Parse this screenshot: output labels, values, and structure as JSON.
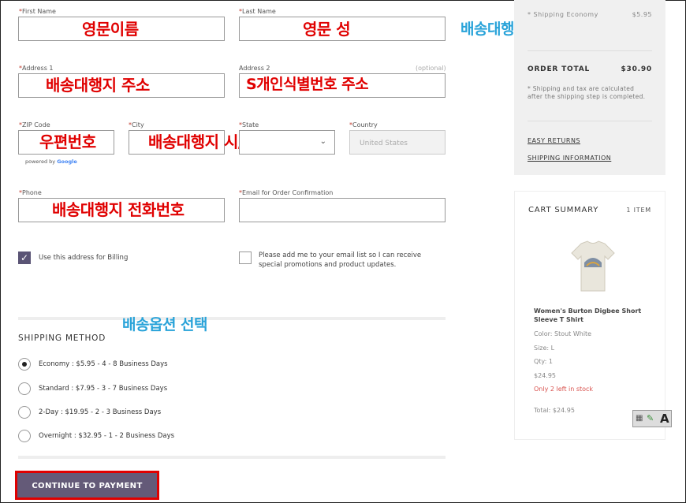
{
  "form": {
    "first_name_label": "First Name",
    "last_name_label": "Last Name",
    "address1_label": "Address 1",
    "address2_label": "Address 2",
    "address2_optional": "(optional)",
    "zip_label": "ZIP Code",
    "city_label": "City",
    "state_label": "State",
    "country_label": "Country",
    "country_value": "United States",
    "powered_by": "powered by",
    "google": "Google",
    "phone_label": "Phone",
    "email_label": "Email for Order Confirmation",
    "billing_checkbox_label": "Use this address for Billing",
    "billing_checked": true,
    "email_list_label": "Please add me to your email list so I can receive special promotions and product updates.",
    "email_list_checked": false
  },
  "annotations": {
    "first_name": "영문이름",
    "last_name": "영문 성",
    "header_hint": "배송대행지 주소입력하기",
    "address1": "배송대행지 주소",
    "address2": "S개인식별번호 주소",
    "zip": "우편번호",
    "city_state": "배송대행지 시/주",
    "phone": "배송대행지 전화번호",
    "shipping_option": "배송옵션 선택"
  },
  "shipping": {
    "title": "SHIPPING METHOD",
    "options": [
      {
        "label": "Economy : $5.95 - 4 - 8 Business Days",
        "selected": true
      },
      {
        "label": "Standard : $7.95 - 3 - 7 Business Days",
        "selected": false
      },
      {
        "label": "2-Day : $19.95 - 2 - 3 Business Days",
        "selected": false
      },
      {
        "label": "Overnight : $32.95 - 1 - 2 Business Days",
        "selected": false
      }
    ]
  },
  "continue_button": "CONTINUE TO PAYMENT",
  "order_summary": {
    "shipping_line_label": "* Shipping Economy",
    "shipping_line_value": "$5.95",
    "order_total_label": "ORDER TOTAL",
    "order_total_value": "$30.90",
    "note": "* Shipping and tax are calculated after the shipping step is completed.",
    "easy_returns": "EASY RETURNS",
    "shipping_info": "SHIPPING INFORMATION"
  },
  "cart": {
    "title": "CART SUMMARY",
    "count": "1 ITEM",
    "item_name": "Women's Burton Digbee Short Sleeve T Shirt",
    "color": "Color: Stout White",
    "size": "Size: L",
    "qty": "Qty: 1",
    "price": "$24.95",
    "stock": "Only 2 left in stock",
    "total": "Total: $24.95"
  },
  "colors": {
    "button": "#645a78",
    "annotation_red": "#e00000",
    "annotation_blue": "#29a3d9",
    "stock_red": "#d9534f"
  }
}
